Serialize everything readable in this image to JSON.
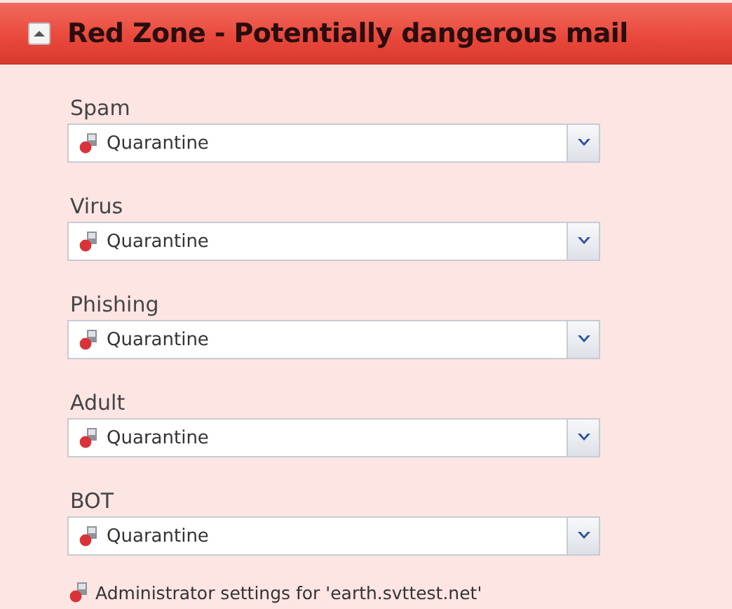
{
  "panel": {
    "title": "Red Zone - Potentially dangerous mail",
    "expanded": true
  },
  "fields": [
    {
      "label": "Spam",
      "value": "Quarantine"
    },
    {
      "label": "Virus",
      "value": "Quarantine"
    },
    {
      "label": "Phishing",
      "value": "Quarantine"
    },
    {
      "label": "Adult",
      "value": "Quarantine"
    },
    {
      "label": "BOT",
      "value": "Quarantine"
    }
  ],
  "footer_link": "Administrator settings for 'earth.svttest.net'"
}
